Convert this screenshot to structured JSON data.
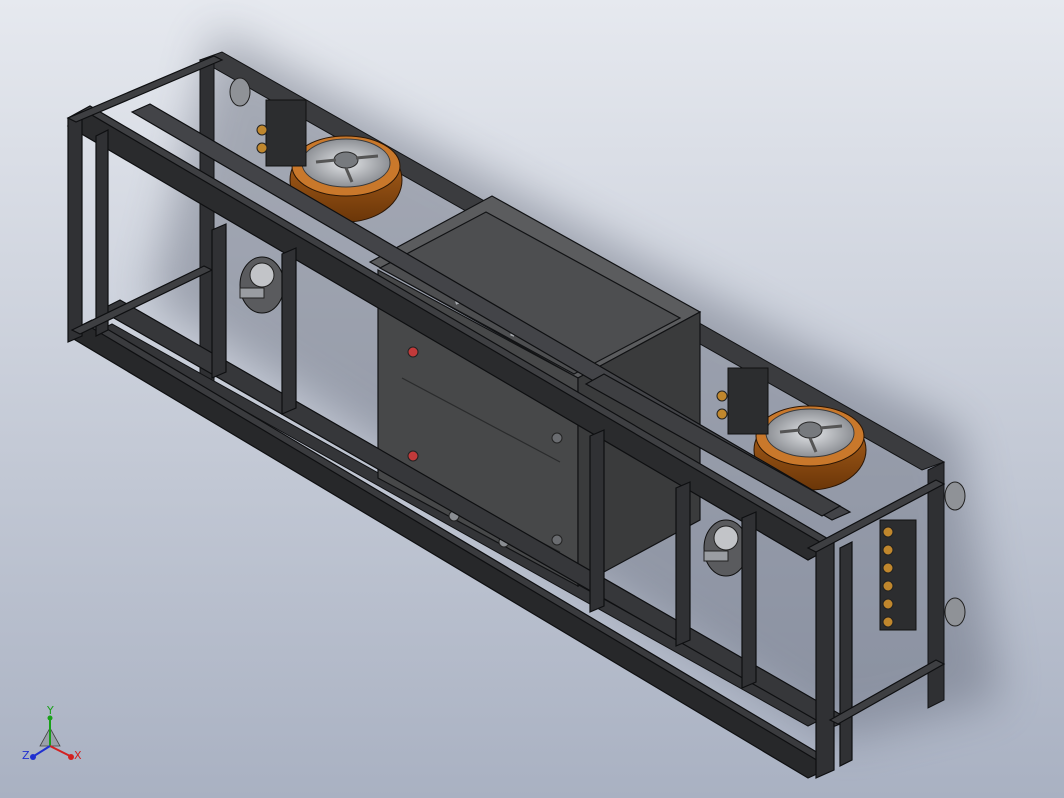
{
  "viewport": {
    "background_top": "#e6e9ef",
    "background_bottom": "#a9b1c2"
  },
  "model": {
    "frame_color": "#3b3c3f",
    "frame_edge_color": "#111214",
    "wheel_tire_color": "#9a5214",
    "wheel_hub_color": "#b4b7bb",
    "box_color": "#474849",
    "connector_color": "#c0872d"
  },
  "triad": {
    "x_label": "X",
    "y_label": "Y",
    "z_label": "Z",
    "x_color": "#d32020",
    "y_color": "#18a018",
    "z_color": "#2030d0"
  }
}
